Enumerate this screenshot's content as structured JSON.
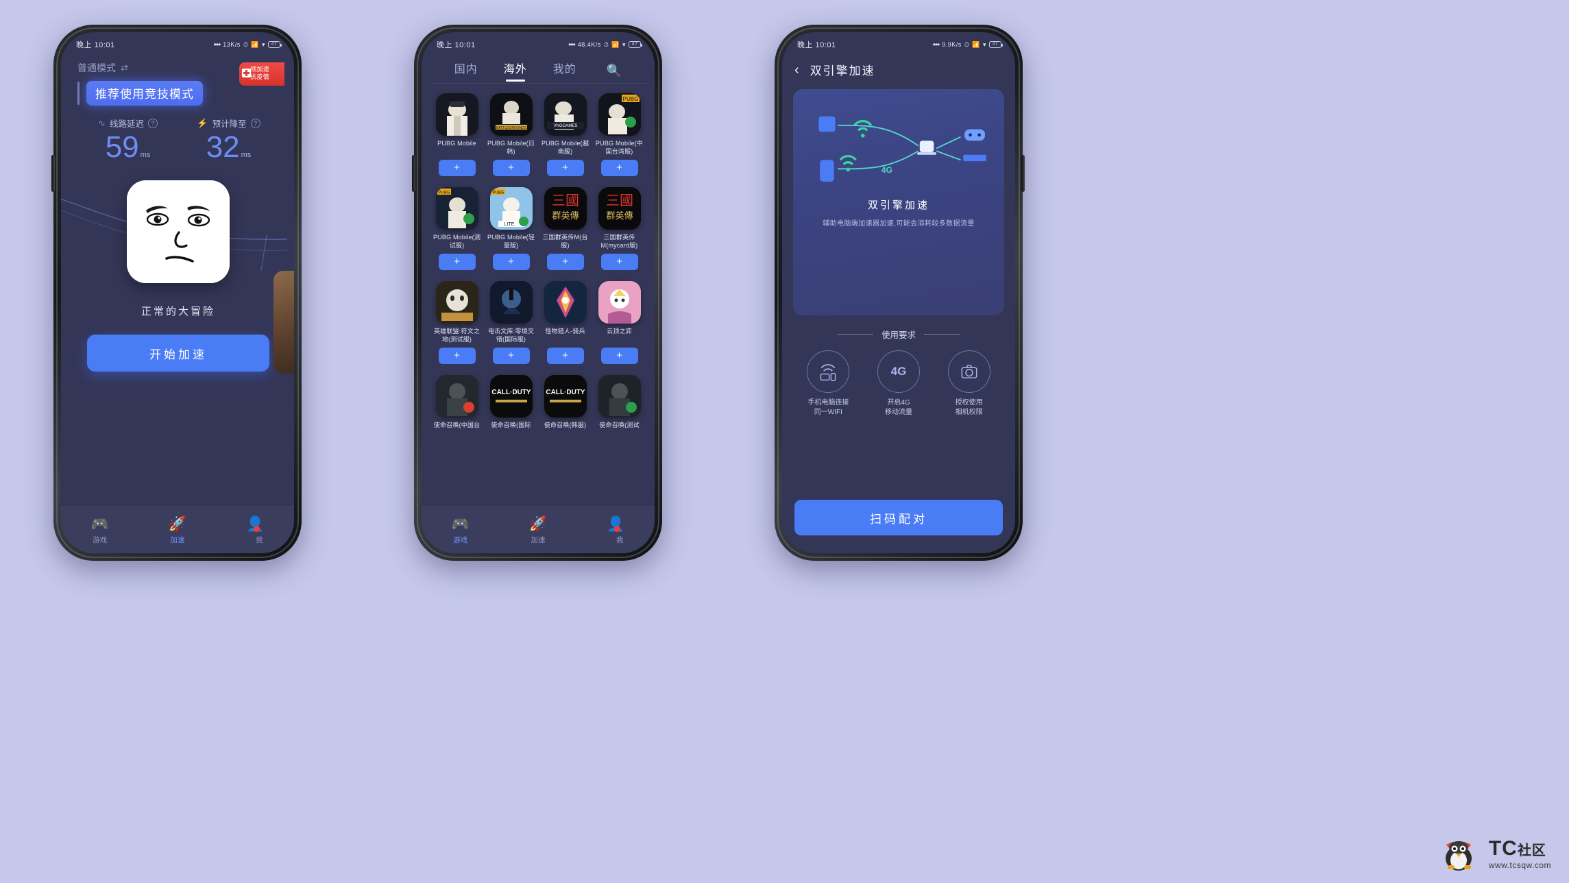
{
  "statusbar": {
    "time": "晚上 10:01",
    "net1": "13K/s",
    "net2": "48.4K/s",
    "net3": "9.9K/s",
    "battery": "47"
  },
  "phone1": {
    "mode_label": "普通模式",
    "swap_icon": "swap-icon",
    "tip": "推荐使用竞技模式",
    "stats": [
      {
        "icon": "wave-icon",
        "label": "线路延迟",
        "help": "?",
        "value": "59",
        "unit": "ms"
      },
      {
        "icon": "lightning-icon",
        "label": "预计降至",
        "help": "?",
        "value": "32",
        "unit": "ms"
      }
    ],
    "promo": {
      "line1": "领加速",
      "line2": "抗疫情",
      "icon": "medical-cross-icon"
    },
    "game_title": "正常的大冒险",
    "cta": "开始加速",
    "tabs": [
      {
        "icon": "gamepad-icon",
        "label": "游戏",
        "active": false,
        "badge": false
      },
      {
        "icon": "rocket-icon",
        "label": "加速",
        "active": true,
        "badge": false
      },
      {
        "icon": "user-icon",
        "label": "我",
        "active": false,
        "badge": true
      }
    ]
  },
  "phone2": {
    "tabs": [
      {
        "label": "国内",
        "active": false
      },
      {
        "label": "海外",
        "active": true
      },
      {
        "label": "我的",
        "active": false
      }
    ],
    "search_icon": "search-icon",
    "add_label": "+",
    "rows": [
      [
        {
          "name": "PUBG Mobile",
          "art": "pubg-white"
        },
        {
          "name": "PUBG Mobile(日韩)",
          "art": "pubg-bg"
        },
        {
          "name": "PUBG Mobile(越南服)",
          "art": "pubg-uni"
        },
        {
          "name": "PUBG Mobile(中国台湾服)",
          "art": "pubg-tw"
        }
      ],
      [
        {
          "name": "PUBG Mobile(测试服)",
          "art": "pubg-beta"
        },
        {
          "name": "PUBG Mobile(轻量版)",
          "art": "pubg-lite"
        },
        {
          "name": "三国群英传M(台服)",
          "art": "sanguo-a"
        },
        {
          "name": "三国群英传M(mycard版)",
          "art": "sanguo-b"
        }
      ],
      [
        {
          "name": "英雄联盟:符文之地(测试服)",
          "art": "lor"
        },
        {
          "name": "电击文库:零境交错(国际服)",
          "art": "dengeki"
        },
        {
          "name": "怪物猎人-骑兵",
          "art": "monster"
        },
        {
          "name": "云顶之弈",
          "art": "tft"
        }
      ],
      [
        {
          "name": "使命召唤(中国台",
          "art": "cod-a"
        },
        {
          "name": "使命召唤(国际",
          "art": "cod-b"
        },
        {
          "name": "使命召唤(韩服)",
          "art": "cod-c"
        },
        {
          "name": "使命召唤(测试",
          "art": "cod-d"
        }
      ]
    ],
    "bottom_tabs": [
      {
        "icon": "gamepad-icon",
        "label": "游戏",
        "active": true,
        "badge": false
      },
      {
        "icon": "rocket-icon",
        "label": "加速",
        "active": false,
        "badge": false
      },
      {
        "icon": "user-icon",
        "label": "我",
        "active": false,
        "badge": true
      }
    ]
  },
  "phone3": {
    "back_icon": "chevron-left-icon",
    "title": "双引擎加速",
    "card_title": "双引擎加速",
    "card_desc": "辅助电脑端加速器加速,可能会消耗较多数据流量",
    "diagram": {
      "label_4g": "4G",
      "nodes": [
        "router-icon",
        "wifi-icon",
        "phone-icon",
        "laptop-icon",
        "gamepad-icon"
      ]
    },
    "requirements_heading": "使用要求",
    "requirements": [
      {
        "icon": "wifi-devices-icon",
        "text": "手机电脑连接\n同一WIFI",
        "line1": "手机电脑连接",
        "line2": "同一WIFI"
      },
      {
        "icon": "4g-icon",
        "text": "开启4G移动流量",
        "line1": "开启4G",
        "line2": "移动流量"
      },
      {
        "icon": "camera-icon",
        "text": "授权使用相机权限",
        "line1": "授权使用",
        "line2": "相机权限"
      }
    ],
    "cta": "扫码配对"
  },
  "watermark": {
    "big": "TC",
    "big_cn": "社区",
    "small": "www.tcsqw.com",
    "logo": "penguin-logo"
  },
  "colors": {
    "accent": "#4a7cf6",
    "screen_bg": "#343657",
    "page_bg": "#c5c8eb",
    "badge": "#f03b3b"
  }
}
